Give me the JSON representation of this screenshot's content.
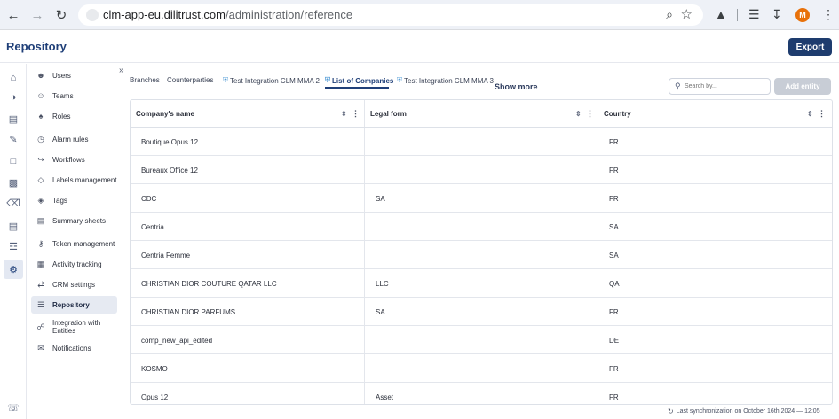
{
  "browser": {
    "url_host": "clm-app-eu.dilitrust.com",
    "url_path": "/administration/reference",
    "profile_initial": "M"
  },
  "header": {
    "title": "Repository",
    "export_label": "Export"
  },
  "rail": {
    "icons": [
      "home-icon",
      "dashboard-icon",
      "contracts-icon",
      "edit-icon",
      "folder-icon",
      "shared-folder-icon",
      "trash-icon",
      "reports-icon",
      "document-list-icon",
      "settings-icon",
      "support-icon"
    ]
  },
  "menu": {
    "items": [
      {
        "label": "Users",
        "icon": "user-icon",
        "active": false
      },
      {
        "label": "Teams",
        "icon": "team-icon",
        "active": false
      },
      {
        "label": "Roles",
        "icon": "role-icon",
        "active": false
      },
      {
        "label": "Alarm rules",
        "icon": "alarm-icon",
        "active": false
      },
      {
        "label": "Workflows",
        "icon": "workflow-icon",
        "active": false
      },
      {
        "label": "Labels management",
        "icon": "label-icon",
        "active": false
      },
      {
        "label": "Tags",
        "icon": "tag-icon",
        "active": false
      },
      {
        "label": "Summary sheets",
        "icon": "summary-icon",
        "active": false
      },
      {
        "label": "Token management",
        "icon": "key-icon",
        "active": false
      },
      {
        "label": "Activity tracking",
        "icon": "activity-icon",
        "active": false
      },
      {
        "label": "CRM settings",
        "icon": "crm-icon",
        "active": false
      },
      {
        "label": "Repository",
        "icon": "list-icon",
        "active": true
      },
      {
        "label": "Integration with Entities",
        "icon": "integration-icon",
        "active": false
      },
      {
        "label": "Notifications",
        "icon": "mail-icon",
        "active": false
      }
    ]
  },
  "tabs": [
    {
      "label": "Branches",
      "shield": false,
      "active": false
    },
    {
      "label": "Counterparties",
      "shield": false,
      "active": false
    },
    {
      "label": "Test Integration CLM MMA 2",
      "shield": true,
      "active": false
    },
    {
      "label": "List of Companies",
      "shield": true,
      "active": true
    },
    {
      "label": "Test Integration CLM MMA 3",
      "shield": true,
      "active": false
    }
  ],
  "show_more_label": "Show more",
  "search": {
    "placeholder": "Search by...",
    "value": ""
  },
  "add_entity_label": "Add entity",
  "table": {
    "columns": [
      "Company's name",
      "Legal form",
      "Country"
    ],
    "rows": [
      [
        "Boutique Opus 12",
        "",
        "FR"
      ],
      [
        "Bureaux Office 12",
        "",
        "FR"
      ],
      [
        "CDC",
        "SA",
        "FR"
      ],
      [
        "Centria",
        "",
        "SA"
      ],
      [
        "Centria Femme",
        "",
        "SA"
      ],
      [
        "CHRISTIAN DIOR COUTURE QATAR LLC",
        "LLC",
        "QA"
      ],
      [
        "CHRISTIAN DIOR PARFUMS",
        "SA",
        "FR"
      ],
      [
        "comp_new_api_edited",
        "",
        "DE"
      ],
      [
        "KOSMO",
        "",
        "FR"
      ],
      [
        "Opus 12",
        "Asset",
        "FR"
      ]
    ]
  },
  "sync_text": "Last synchronization on October 16th 2024 — 12:05"
}
